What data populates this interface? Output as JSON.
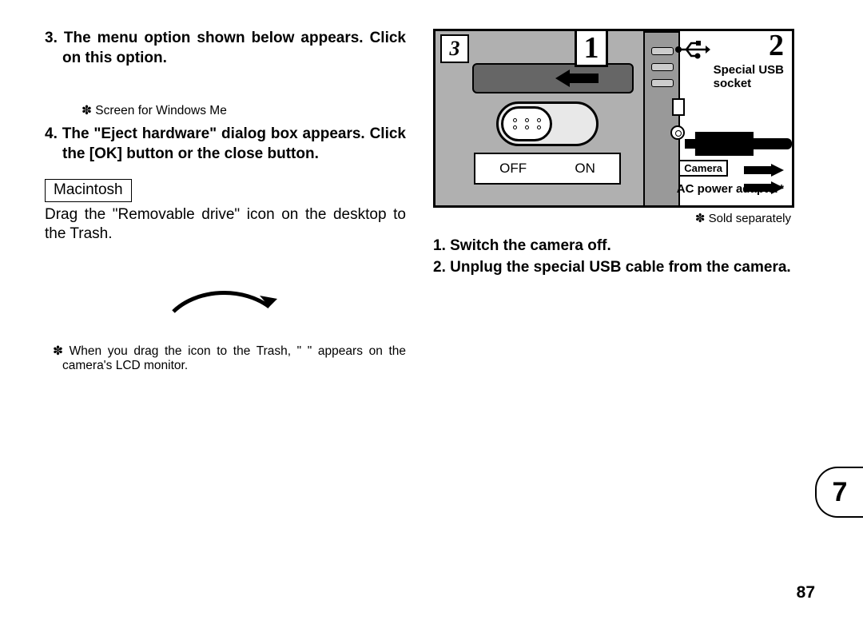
{
  "left": {
    "step3": "3. The menu option shown below appears. Click on this option.",
    "winnote": "✽ Screen for Windows Me",
    "step4": "4. The \"Eject hardware\" dialog box appears. Click the [OK] button or the close button.",
    "mac_label": "Macintosh",
    "mac_body": "Drag the \"Removable drive\" icon on the desktop to the Trash.",
    "mac_note": "✽ When you drag the icon to the Trash, \"                    \" appears on the camera's LCD monitor."
  },
  "right": {
    "fig": {
      "callout3": "3",
      "callout1": "1",
      "callout2": "2",
      "off": "OFF",
      "on": "ON",
      "usb_label_l1": "Special USB",
      "usb_label_l2": "socket",
      "camera_tag": "Camera",
      "ac_label": "AC power adapter*"
    },
    "sold": "✽ Sold separately",
    "step1": "1. Switch the camera off.",
    "step2": "2. Unplug the special USB cable from the camera."
  },
  "chapter_tab": "7",
  "page_number": "87"
}
